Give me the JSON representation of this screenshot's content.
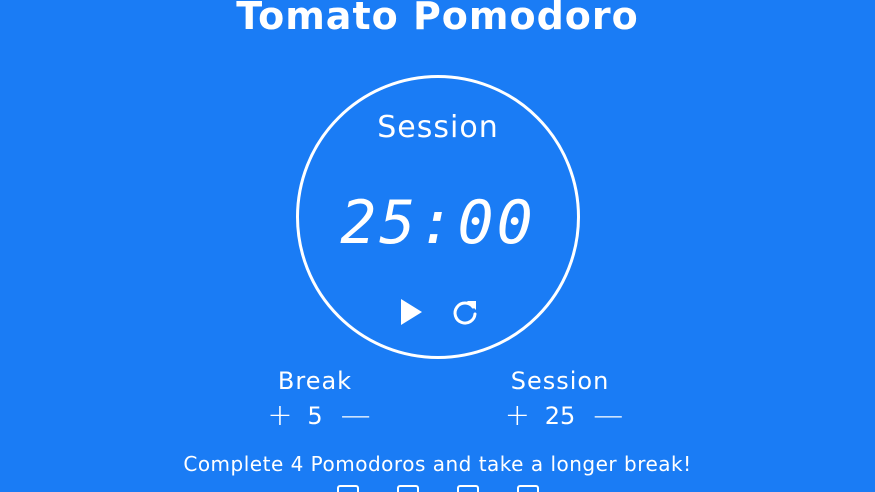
{
  "app": {
    "title": "Tomato Pomodoro"
  },
  "timer": {
    "label": "Session",
    "display": "25:00",
    "play_icon": "play-icon",
    "reset_icon": "reset-icon"
  },
  "break_setting": {
    "label": "Break",
    "increment": "+",
    "value": "5",
    "decrement": "—"
  },
  "session_setting": {
    "label": "Session",
    "increment": "+",
    "value": "25",
    "decrement": "—"
  },
  "footer": {
    "text": "Complete 4 Pomodoros and take a longer break!",
    "pomodoro_count": 4
  },
  "colors": {
    "background": "#1a7cf5",
    "foreground": "#ffffff"
  }
}
